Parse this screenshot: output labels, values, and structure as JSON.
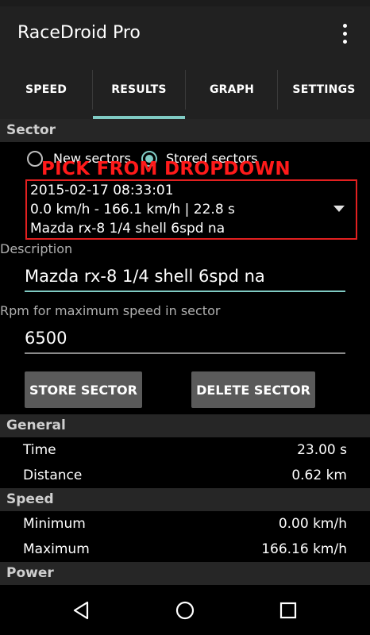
{
  "app": {
    "title": "RaceDroid Pro"
  },
  "tabs": [
    {
      "label": "SPEED"
    },
    {
      "label": "RESULTS"
    },
    {
      "label": "GRAPH"
    },
    {
      "label": "SETTINGS"
    }
  ],
  "sector": {
    "header": "Sector",
    "radio_new": "New sectors",
    "radio_stored": "Stored sectors",
    "selected": "stored",
    "annotation": "PICK FROM DROPDOWN",
    "dropdown": {
      "line1": "2015-02-17 08:33:01",
      "line2": "0.0 km/h - 166.1 km/h | 22.8 s",
      "line3": "Mazda rx-8 1/4 shell 6spd na"
    },
    "description_label": "Description",
    "description_value": "Mazda rx-8 1/4 shell 6spd na",
    "rpm_label": "Rpm for maximum speed in sector",
    "rpm_value": "6500",
    "store_button": "STORE SECTOR",
    "delete_button": "DELETE SECTOR"
  },
  "general": {
    "header": "General",
    "rows": [
      {
        "label": "Time",
        "value": "23.00 s"
      },
      {
        "label": "Distance",
        "value": "0.62 km"
      }
    ]
  },
  "speed": {
    "header": "Speed",
    "rows": [
      {
        "label": "Minimum",
        "value": "0.00 km/h"
      },
      {
        "label": "Maximum",
        "value": "166.16 km/h"
      }
    ]
  },
  "power": {
    "header": "Power"
  },
  "colors": {
    "accent": "#80cbc4",
    "annotation": "#ff1a1a",
    "appbar": "#212121"
  },
  "icons": {
    "overflow": "more-vert-icon",
    "back": "back-icon",
    "home": "home-icon",
    "recents": "recents-icon"
  }
}
